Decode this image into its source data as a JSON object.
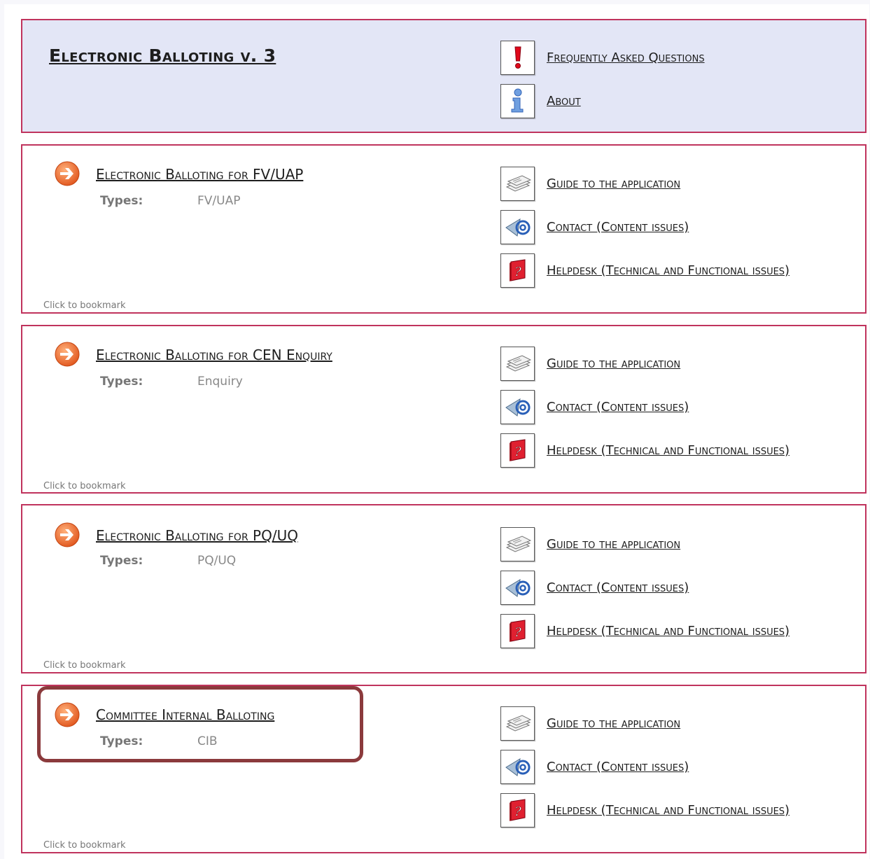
{
  "header": {
    "title": "Electronic Balloting v. 3",
    "links": [
      {
        "label": "Frequently Asked Questions",
        "icon": "exclamation-icon"
      },
      {
        "label": "About",
        "icon": "info-icon"
      }
    ]
  },
  "sections": [
    {
      "title": "Electronic Balloting for FV/UAP",
      "types_label": "Types:",
      "types_value": "FV/UAP",
      "bookmark": "Click to bookmark",
      "links": [
        {
          "label": "Guide to the application",
          "icon": "documents-icon"
        },
        {
          "label": "Contact (Content issues)",
          "icon": "email-icon"
        },
        {
          "label": "Helpdesk (Technical and Functional issues)",
          "icon": "help-book-icon"
        }
      ]
    },
    {
      "title": "Electronic Balloting for CEN Enquiry",
      "types_label": "Types:",
      "types_value": "Enquiry",
      "bookmark": "Click to bookmark",
      "links": [
        {
          "label": "Guide to the application",
          "icon": "documents-icon"
        },
        {
          "label": "Contact (Content issues)",
          "icon": "email-icon"
        },
        {
          "label": "Helpdesk (Technical and Functional issues)",
          "icon": "help-book-icon"
        }
      ]
    },
    {
      "title": "Electronic Balloting for PQ/UQ",
      "types_label": "Types:",
      "types_value": "PQ/UQ",
      "bookmark": "Click to bookmark",
      "links": [
        {
          "label": "Guide to the application",
          "icon": "documents-icon"
        },
        {
          "label": "Contact (Content issues)",
          "icon": "email-icon"
        },
        {
          "label": "Helpdesk (Technical and Functional issues)",
          "icon": "help-book-icon"
        }
      ]
    },
    {
      "title": "Committee Internal Balloting",
      "types_label": "Types:",
      "types_value": "CIB",
      "bookmark": "Click to bookmark",
      "links": [
        {
          "label": "Guide to the application",
          "icon": "documents-icon"
        },
        {
          "label": "Contact (Content issues)",
          "icon": "email-icon"
        },
        {
          "label": "Helpdesk (Technical and Functional issues)",
          "icon": "help-book-icon"
        }
      ]
    }
  ],
  "colors": {
    "panel_border": "#c0335d",
    "header_bg": "#e3e6f6",
    "arrow": "#ee6b2f",
    "highlight_border": "#8b3a3c"
  }
}
